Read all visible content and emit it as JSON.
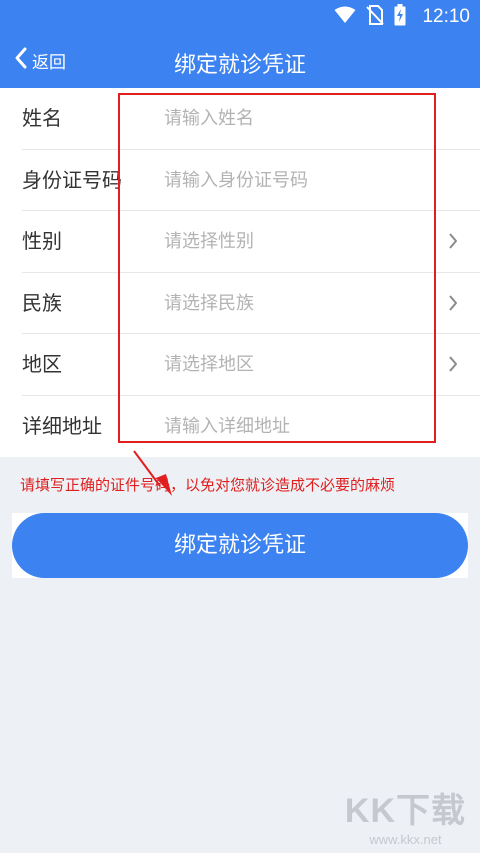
{
  "status_bar": {
    "time": "12:10"
  },
  "header": {
    "back_label": "返回",
    "title": "绑定就诊凭证"
  },
  "form": {
    "fields": [
      {
        "label": "姓名",
        "placeholder": "请输入姓名",
        "has_chevron": false
      },
      {
        "label": "身份证号码",
        "placeholder": "请输入身份证号码",
        "has_chevron": false
      },
      {
        "label": "性别",
        "placeholder": "请选择性别",
        "has_chevron": true
      },
      {
        "label": "民族",
        "placeholder": "请选择民族",
        "has_chevron": true
      },
      {
        "label": "地区",
        "placeholder": "请选择地区",
        "has_chevron": true
      },
      {
        "label": "详细地址",
        "placeholder": "请输入详细地址",
        "has_chevron": false
      }
    ]
  },
  "tip": "请填写正确的证件号码，以免对您就诊造成不必要的麻烦",
  "submit_button": "绑定就诊凭证",
  "watermark": {
    "brand": "KK下载",
    "url": "www.kkx.net"
  },
  "colors": {
    "primary": "#3c82f0",
    "annotation": "#e02020",
    "background": "#edf0f4"
  }
}
